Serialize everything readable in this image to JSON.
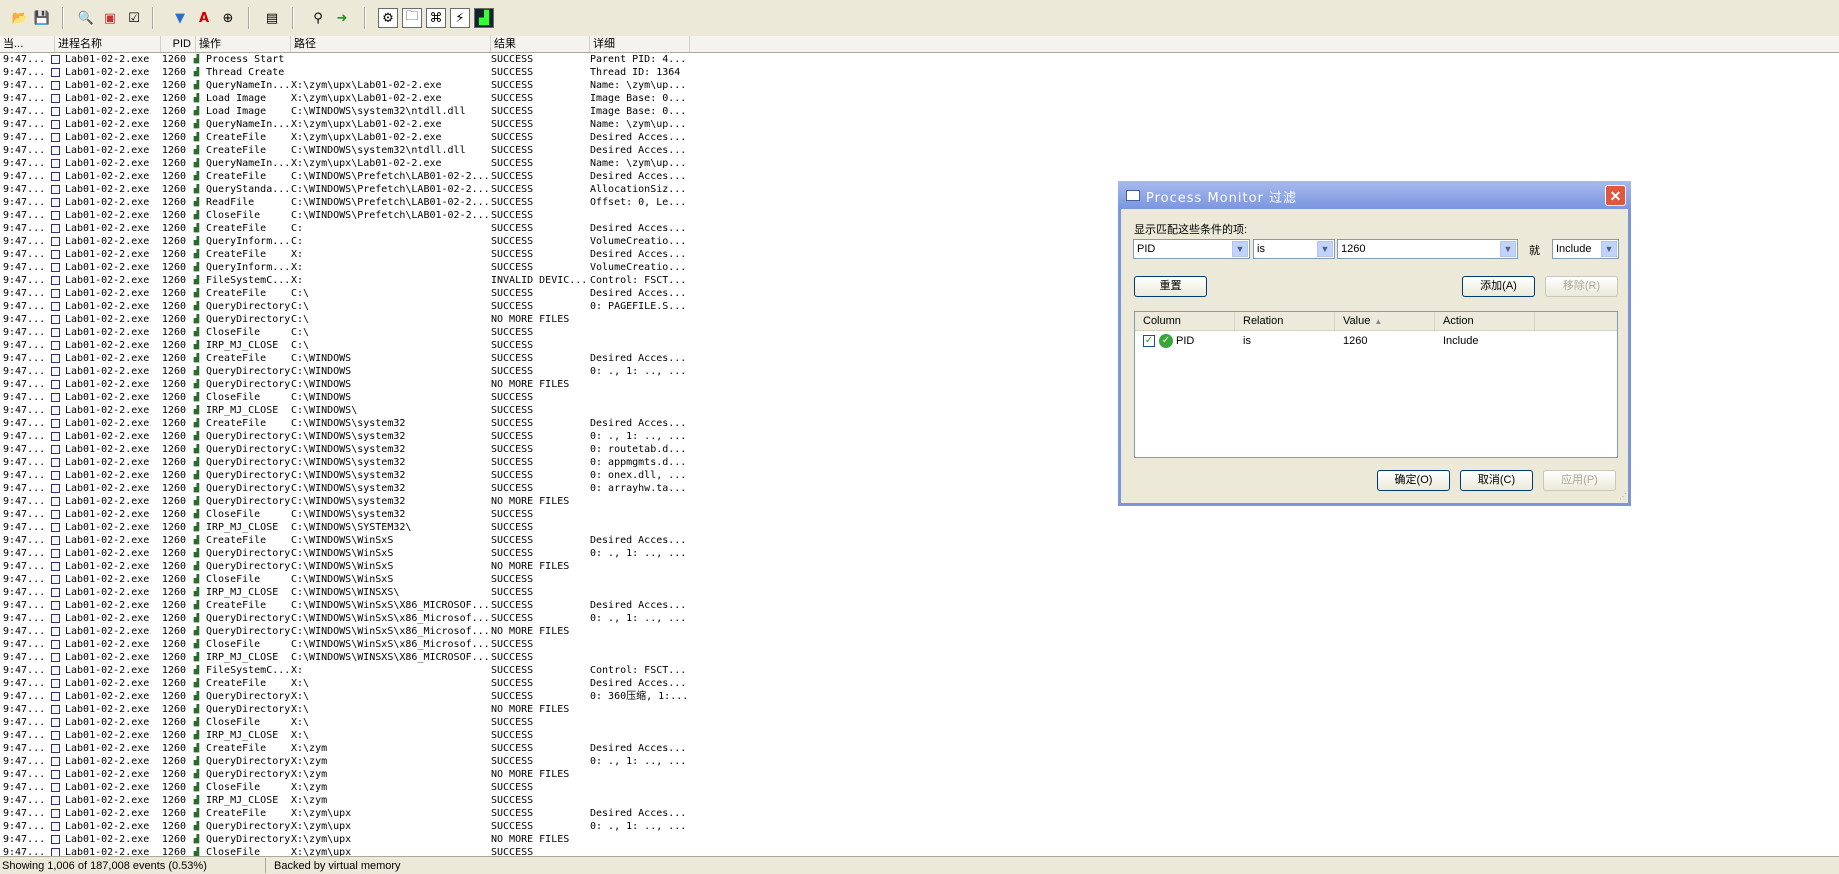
{
  "toolbar": {
    "icons": [
      "open-icon",
      "save-icon",
      "magnify-icon",
      "autoscroll-icon",
      "clear-icon",
      "filter-icon",
      "highlight-icon",
      "target-icon",
      "jump-icon",
      "find-icon",
      "jump-to-icon",
      "registry-icon",
      "filesystem-icon",
      "network-icon",
      "process-icon",
      "profiling-icon"
    ]
  },
  "columns": [
    "当...",
    "进程名称",
    "PID",
    "操作",
    "路径",
    "结果",
    "详细"
  ],
  "rows": [
    [
      "9:47...",
      "Lab01-02-2.exe",
      "1260",
      "Process Start",
      "",
      "SUCCESS",
      "Parent PID: 4..."
    ],
    [
      "9:47...",
      "Lab01-02-2.exe",
      "1260",
      "Thread Create",
      "",
      "SUCCESS",
      "Thread ID: 1364"
    ],
    [
      "9:47...",
      "Lab01-02-2.exe",
      "1260",
      "QueryNameIn...",
      "X:\\zym\\upx\\Lab01-02-2.exe",
      "SUCCESS",
      "Name: \\zym\\up..."
    ],
    [
      "9:47...",
      "Lab01-02-2.exe",
      "1260",
      "Load Image",
      "X:\\zym\\upx\\Lab01-02-2.exe",
      "SUCCESS",
      "Image Base: 0..."
    ],
    [
      "9:47...",
      "Lab01-02-2.exe",
      "1260",
      "Load Image",
      "C:\\WINDOWS\\system32\\ntdll.dll",
      "SUCCESS",
      "Image Base: 0..."
    ],
    [
      "9:47...",
      "Lab01-02-2.exe",
      "1260",
      "QueryNameIn...",
      "X:\\zym\\upx\\Lab01-02-2.exe",
      "SUCCESS",
      "Name: \\zym\\up..."
    ],
    [
      "9:47...",
      "Lab01-02-2.exe",
      "1260",
      "CreateFile",
      "X:\\zym\\upx\\Lab01-02-2.exe",
      "SUCCESS",
      "Desired Acces..."
    ],
    [
      "9:47...",
      "Lab01-02-2.exe",
      "1260",
      "CreateFile",
      "C:\\WINDOWS\\system32\\ntdll.dll",
      "SUCCESS",
      "Desired Acces..."
    ],
    [
      "9:47...",
      "Lab01-02-2.exe",
      "1260",
      "QueryNameIn...",
      "X:\\zym\\upx\\Lab01-02-2.exe",
      "SUCCESS",
      "Name: \\zym\\up..."
    ],
    [
      "9:47...",
      "Lab01-02-2.exe",
      "1260",
      "CreateFile",
      "C:\\WINDOWS\\Prefetch\\LAB01-02-2...",
      "SUCCESS",
      "Desired Acces..."
    ],
    [
      "9:47...",
      "Lab01-02-2.exe",
      "1260",
      "QueryStanda...",
      "C:\\WINDOWS\\Prefetch\\LAB01-02-2...",
      "SUCCESS",
      "AllocationSiz..."
    ],
    [
      "9:47...",
      "Lab01-02-2.exe",
      "1260",
      "ReadFile",
      "C:\\WINDOWS\\Prefetch\\LAB01-02-2...",
      "SUCCESS",
      "Offset: 0, Le..."
    ],
    [
      "9:47...",
      "Lab01-02-2.exe",
      "1260",
      "CloseFile",
      "C:\\WINDOWS\\Prefetch\\LAB01-02-2...",
      "SUCCESS",
      ""
    ],
    [
      "9:47...",
      "Lab01-02-2.exe",
      "1260",
      "CreateFile",
      "C:",
      "SUCCESS",
      "Desired Acces..."
    ],
    [
      "9:47...",
      "Lab01-02-2.exe",
      "1260",
      "QueryInform...",
      "C:",
      "SUCCESS",
      "VolumeCreatio..."
    ],
    [
      "9:47...",
      "Lab01-02-2.exe",
      "1260",
      "CreateFile",
      "X:",
      "SUCCESS",
      "Desired Acces..."
    ],
    [
      "9:47...",
      "Lab01-02-2.exe",
      "1260",
      "QueryInform...",
      "X:",
      "SUCCESS",
      "VolumeCreatio..."
    ],
    [
      "9:47...",
      "Lab01-02-2.exe",
      "1260",
      "FileSystemC...",
      "X:",
      "INVALID DEVIC...",
      "Control: FSCT..."
    ],
    [
      "9:47...",
      "Lab01-02-2.exe",
      "1260",
      "CreateFile",
      "C:\\",
      "SUCCESS",
      "Desired Acces..."
    ],
    [
      "9:47...",
      "Lab01-02-2.exe",
      "1260",
      "QueryDirectory",
      "C:\\",
      "SUCCESS",
      "0: PAGEFILE.S..."
    ],
    [
      "9:47...",
      "Lab01-02-2.exe",
      "1260",
      "QueryDirectory",
      "C:\\",
      "NO MORE FILES",
      ""
    ],
    [
      "9:47...",
      "Lab01-02-2.exe",
      "1260",
      "CloseFile",
      "C:\\",
      "SUCCESS",
      ""
    ],
    [
      "9:47...",
      "Lab01-02-2.exe",
      "1260",
      "IRP_MJ_CLOSE",
      "C:\\",
      "SUCCESS",
      ""
    ],
    [
      "9:47...",
      "Lab01-02-2.exe",
      "1260",
      "CreateFile",
      "C:\\WINDOWS",
      "SUCCESS",
      "Desired Acces..."
    ],
    [
      "9:47...",
      "Lab01-02-2.exe",
      "1260",
      "QueryDirectory",
      "C:\\WINDOWS",
      "SUCCESS",
      "0: ., 1: .., ..."
    ],
    [
      "9:47...",
      "Lab01-02-2.exe",
      "1260",
      "QueryDirectory",
      "C:\\WINDOWS",
      "NO MORE FILES",
      ""
    ],
    [
      "9:47...",
      "Lab01-02-2.exe",
      "1260",
      "CloseFile",
      "C:\\WINDOWS",
      "SUCCESS",
      ""
    ],
    [
      "9:47...",
      "Lab01-02-2.exe",
      "1260",
      "IRP_MJ_CLOSE",
      "C:\\WINDOWS\\",
      "SUCCESS",
      ""
    ],
    [
      "9:47...",
      "Lab01-02-2.exe",
      "1260",
      "CreateFile",
      "C:\\WINDOWS\\system32",
      "SUCCESS",
      "Desired Acces..."
    ],
    [
      "9:47...",
      "Lab01-02-2.exe",
      "1260",
      "QueryDirectory",
      "C:\\WINDOWS\\system32",
      "SUCCESS",
      "0: ., 1: .., ..."
    ],
    [
      "9:47...",
      "Lab01-02-2.exe",
      "1260",
      "QueryDirectory",
      "C:\\WINDOWS\\system32",
      "SUCCESS",
      "0: routetab.d..."
    ],
    [
      "9:47...",
      "Lab01-02-2.exe",
      "1260",
      "QueryDirectory",
      "C:\\WINDOWS\\system32",
      "SUCCESS",
      "0: appmgmts.d..."
    ],
    [
      "9:47...",
      "Lab01-02-2.exe",
      "1260",
      "QueryDirectory",
      "C:\\WINDOWS\\system32",
      "SUCCESS",
      "0: onex.dll, ..."
    ],
    [
      "9:47...",
      "Lab01-02-2.exe",
      "1260",
      "QueryDirectory",
      "C:\\WINDOWS\\system32",
      "SUCCESS",
      "0: arrayhw.ta..."
    ],
    [
      "9:47...",
      "Lab01-02-2.exe",
      "1260",
      "QueryDirectory",
      "C:\\WINDOWS\\system32",
      "NO MORE FILES",
      ""
    ],
    [
      "9:47...",
      "Lab01-02-2.exe",
      "1260",
      "CloseFile",
      "C:\\WINDOWS\\system32",
      "SUCCESS",
      ""
    ],
    [
      "9:47...",
      "Lab01-02-2.exe",
      "1260",
      "IRP_MJ_CLOSE",
      "C:\\WINDOWS\\SYSTEM32\\",
      "SUCCESS",
      ""
    ],
    [
      "9:47...",
      "Lab01-02-2.exe",
      "1260",
      "CreateFile",
      "C:\\WINDOWS\\WinSxS",
      "SUCCESS",
      "Desired Acces..."
    ],
    [
      "9:47...",
      "Lab01-02-2.exe",
      "1260",
      "QueryDirectory",
      "C:\\WINDOWS\\WinSxS",
      "SUCCESS",
      "0: ., 1: .., ..."
    ],
    [
      "9:47...",
      "Lab01-02-2.exe",
      "1260",
      "QueryDirectory",
      "C:\\WINDOWS\\WinSxS",
      "NO MORE FILES",
      ""
    ],
    [
      "9:47...",
      "Lab01-02-2.exe",
      "1260",
      "CloseFile",
      "C:\\WINDOWS\\WinSxS",
      "SUCCESS",
      ""
    ],
    [
      "9:47...",
      "Lab01-02-2.exe",
      "1260",
      "IRP_MJ_CLOSE",
      "C:\\WINDOWS\\WINSXS\\",
      "SUCCESS",
      ""
    ],
    [
      "9:47...",
      "Lab01-02-2.exe",
      "1260",
      "CreateFile",
      "C:\\WINDOWS\\WinSxS\\X86_MICROSOF...",
      "SUCCESS",
      "Desired Acces..."
    ],
    [
      "9:47...",
      "Lab01-02-2.exe",
      "1260",
      "QueryDirectory",
      "C:\\WINDOWS\\WinSxS\\x86_Microsof...",
      "SUCCESS",
      "0: ., 1: .., ..."
    ],
    [
      "9:47...",
      "Lab01-02-2.exe",
      "1260",
      "QueryDirectory",
      "C:\\WINDOWS\\WinSxS\\x86_Microsof...",
      "NO MORE FILES",
      ""
    ],
    [
      "9:47...",
      "Lab01-02-2.exe",
      "1260",
      "CloseFile",
      "C:\\WINDOWS\\WinSxS\\x86_Microsof...",
      "SUCCESS",
      ""
    ],
    [
      "9:47...",
      "Lab01-02-2.exe",
      "1260",
      "IRP_MJ_CLOSE",
      "C:\\WINDOWS\\WINSXS\\X86_MICROSOF...",
      "SUCCESS",
      ""
    ],
    [
      "9:47...",
      "Lab01-02-2.exe",
      "1260",
      "FileSystemC...",
      "X:",
      "SUCCESS",
      "Control: FSCT..."
    ],
    [
      "9:47...",
      "Lab01-02-2.exe",
      "1260",
      "CreateFile",
      "X:\\",
      "SUCCESS",
      "Desired Acces..."
    ],
    [
      "9:47...",
      "Lab01-02-2.exe",
      "1260",
      "QueryDirectory",
      "X:\\",
      "SUCCESS",
      "0: 360压缩, 1:..."
    ],
    [
      "9:47...",
      "Lab01-02-2.exe",
      "1260",
      "QueryDirectory",
      "X:\\",
      "NO MORE FILES",
      ""
    ],
    [
      "9:47...",
      "Lab01-02-2.exe",
      "1260",
      "CloseFile",
      "X:\\",
      "SUCCESS",
      ""
    ],
    [
      "9:47...",
      "Lab01-02-2.exe",
      "1260",
      "IRP_MJ_CLOSE",
      "X:\\",
      "SUCCESS",
      ""
    ],
    [
      "9:47...",
      "Lab01-02-2.exe",
      "1260",
      "CreateFile",
      "X:\\zym",
      "SUCCESS",
      "Desired Acces..."
    ],
    [
      "9:47...",
      "Lab01-02-2.exe",
      "1260",
      "QueryDirectory",
      "X:\\zym",
      "SUCCESS",
      "0: ., 1: .., ..."
    ],
    [
      "9:47...",
      "Lab01-02-2.exe",
      "1260",
      "QueryDirectory",
      "X:\\zym",
      "NO MORE FILES",
      ""
    ],
    [
      "9:47...",
      "Lab01-02-2.exe",
      "1260",
      "CloseFile",
      "X:\\zym",
      "SUCCESS",
      ""
    ],
    [
      "9:47...",
      "Lab01-02-2.exe",
      "1260",
      "IRP_MJ_CLOSE",
      "X:\\zym",
      "SUCCESS",
      ""
    ],
    [
      "9:47...",
      "Lab01-02-2.exe",
      "1260",
      "CreateFile",
      "X:\\zym\\upx",
      "SUCCESS",
      "Desired Acces..."
    ],
    [
      "9:47...",
      "Lab01-02-2.exe",
      "1260",
      "QueryDirectory",
      "X:\\zym\\upx",
      "SUCCESS",
      "0: ., 1: .., ..."
    ],
    [
      "9:47...",
      "Lab01-02-2.exe",
      "1260",
      "QueryDirectory",
      "X:\\zym\\upx",
      "NO MORE FILES",
      ""
    ],
    [
      "9:47...",
      "Lab01-02-2.exe",
      "1260",
      "CloseFile",
      "X:\\zym\\upx",
      "SUCCESS",
      ""
    ]
  ],
  "status": {
    "events": "Showing 1,006 of 187,008 events (0.53%)",
    "memory": "Backed by virtual memory"
  },
  "dialog": {
    "title": "Process Monitor 过滤",
    "close": "✕",
    "label": "显示匹配这些条件的项:",
    "column_value": "PID",
    "relation_value": "is",
    "value_value": "1260",
    "jiu": "就",
    "action_value": "Include",
    "reset": "重置",
    "add": "添加(A)",
    "remove": "移除(R)",
    "list_headers": [
      "Column",
      "Relation",
      "Value",
      "Action"
    ],
    "list_rows": [
      {
        "column": "PID",
        "relation": "is",
        "value": "1260",
        "action": "Include",
        "checked": true
      }
    ],
    "ok": "确定(O)",
    "cancel": "取消(C)",
    "apply": "应用(P)"
  }
}
